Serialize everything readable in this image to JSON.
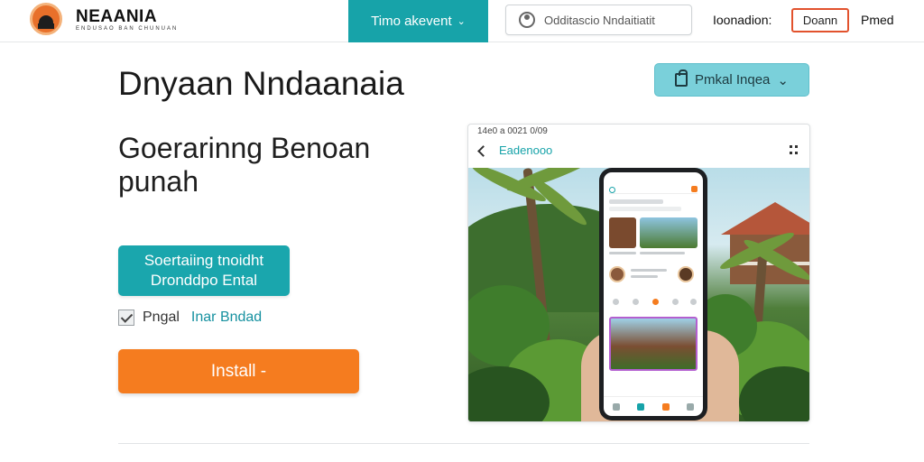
{
  "nav": {
    "brand_name": "NEAANIA",
    "brand_tagline": "ENDUSAO BAN CHUNUAN",
    "active_tab": "Timo akevent",
    "search_placeholder": "Odditascio Nndaitiatit",
    "link_1": "Ioonadion:",
    "link_outlined": "Doann",
    "link_3": "Pmed"
  },
  "hero": {
    "headline": "Dnyaan Nndaanaia",
    "subhead": "Goerarinng Benoan punah",
    "cta_line_1": "Soertaiing tnoidht",
    "cta_line_2": "Dronddpo Ental",
    "checkbox_label": "Pngal",
    "checkbox_link": "Inar Bndad",
    "checkbox_checked": true,
    "install_label": "Install -"
  },
  "preview": {
    "region_button_label": "Pmkal Inqea",
    "device_status": "14e0 a 0021 0/09",
    "device_title": "Eadenooo",
    "colors": {
      "teal": "#17a3a9",
      "orange": "#f57c1f",
      "outline_red": "#e2522d"
    }
  }
}
